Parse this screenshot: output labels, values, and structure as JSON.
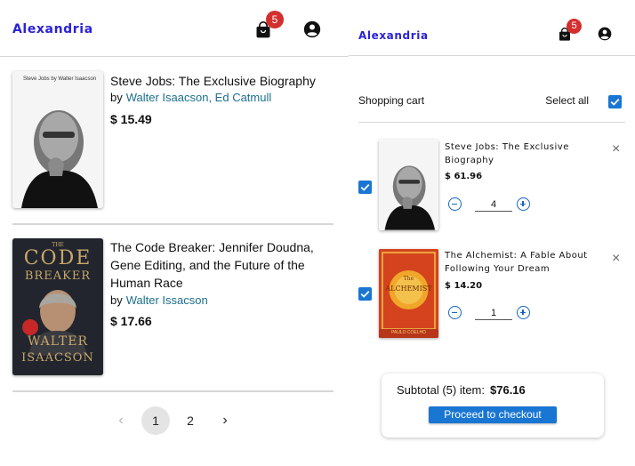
{
  "brand": "Alexandria",
  "cart_count": "5",
  "colors": {
    "brand": "#2a22d6",
    "badge": "#d32f2f",
    "accent": "#1976d2",
    "link": "#1b6f8c"
  },
  "listing": {
    "products": [
      {
        "title": "Steve Jobs: The Exclusive Biography",
        "by_label": "by",
        "authors": "Walter Isaacson, Ed Catmull",
        "price": "$ 15.49",
        "cover_text": "Steve Jobs by Walter Isaacson"
      },
      {
        "title": "The Code Breaker: Jennifer Doudna, Gene Editing, and the Future of the Human Race",
        "by_label": "by",
        "authors": "Walter Issacson",
        "price": "$ 17.66",
        "cover_lines": [
          "THE",
          "CODE",
          "BREAKER",
          "WALTER",
          "ISAACSON"
        ]
      }
    ],
    "pagination": {
      "prev": "‹",
      "pages": [
        "1",
        "2"
      ],
      "current": "1",
      "next": "›"
    }
  },
  "cart": {
    "heading": "Shopping cart",
    "select_all": "Select all",
    "items": [
      {
        "title": "Steve Jobs: The Exclusive Biography",
        "price": "$ 61.96",
        "quantity": "4",
        "remove": "×"
      },
      {
        "title": "The Alchemist: A Fable About Following Your Dream",
        "price": "$ 14.20",
        "quantity": "1",
        "remove": "×",
        "cover_lines": [
          "The",
          "ALCHEMIST",
          "PAULO COELHO"
        ]
      }
    ],
    "subtotal_label": "Subtotal (5) item:",
    "subtotal_value": "$76.16",
    "checkout_label": "Proceed to checkout"
  }
}
